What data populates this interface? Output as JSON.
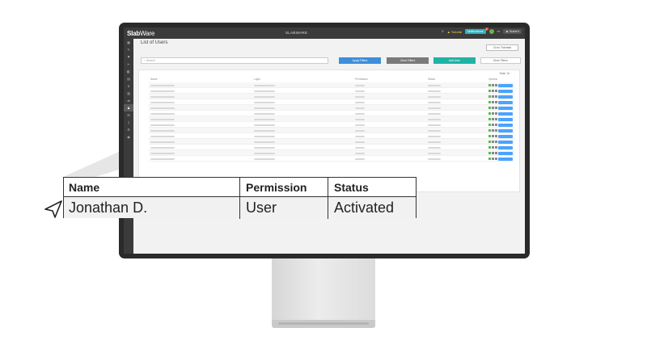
{
  "app": {
    "logo_bold": "Slab",
    "logo_thin": "Ware",
    "title": "SLABWARE",
    "tutorial": "Tutorial",
    "notifications": "Notifications",
    "notifications_badge": "1",
    "user": "Guest"
  },
  "sidebar": {
    "items": [
      "▦",
      "✎",
      "⚑",
      "✂",
      "◧",
      "▤",
      "$",
      "▥",
      "⇄",
      "♟",
      "✉",
      "▯",
      "⚙",
      "◉"
    ],
    "active_index": 9
  },
  "page": {
    "title": "List of Users",
    "back_label": "Go to Tutorials",
    "search_placeholder": "Search",
    "apply_label": "Apply Filters",
    "clear_label": "Clear Filters",
    "add_label": "Add User",
    "more_label": "More Filters",
    "total": "Total: 14",
    "columns": [
      "Name",
      "Login",
      "Permission",
      "Status",
      "Options"
    ],
    "row_count": 14
  },
  "callout": {
    "headers": [
      "Name",
      "Permission",
      "Status"
    ],
    "values": [
      "Jonathan D.",
      "User",
      "Activated"
    ]
  },
  "colors": {
    "topbar": "#3b3b3b",
    "apply": "#3d8edb",
    "clear": "#7a7a7a",
    "add": "#1fb3a6"
  }
}
